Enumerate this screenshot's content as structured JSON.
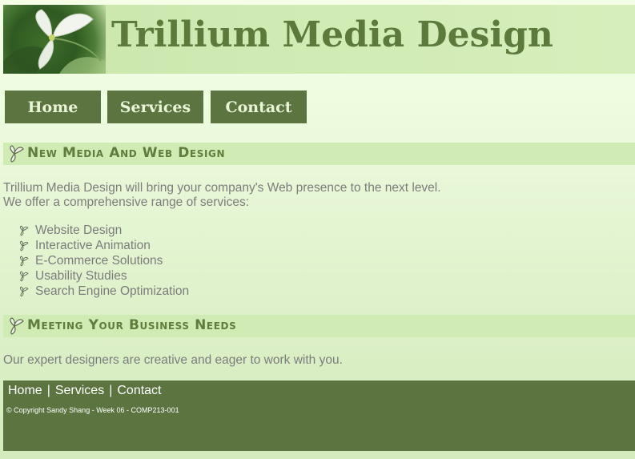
{
  "header": {
    "title": "Trillium Media Design"
  },
  "nav": {
    "items": [
      {
        "label": "Home"
      },
      {
        "label": "Services"
      },
      {
        "label": "Contact"
      }
    ]
  },
  "sections": [
    {
      "heading": "New Media And Web Design",
      "intro_line1": "Trillium Media Design will bring your company's Web presence to the next level.",
      "intro_line2": "We offer a comprehensive range of services:",
      "services": [
        "Website Design",
        "Interactive Animation",
        "E-Commerce Solutions",
        "Usability Studies",
        "Search Engine Optimization"
      ]
    },
    {
      "heading": "Meeting Your Business Needs",
      "text": "Our expert designers are creative and eager to work with you."
    }
  ],
  "footer": {
    "links": [
      "Home",
      "Services",
      "Contact"
    ],
    "separator": "|",
    "copyright": "© Copyright Sandy Shang - Week 06 - COMP213-001"
  },
  "colors": {
    "brand_green": "#5b7440",
    "title_green": "#5b7a3c",
    "section_bar": "#d1ebb4",
    "body_text": "#7c7c7c"
  },
  "icons": [
    "trillium-flower-logo",
    "trillium-bullet-icon"
  ]
}
